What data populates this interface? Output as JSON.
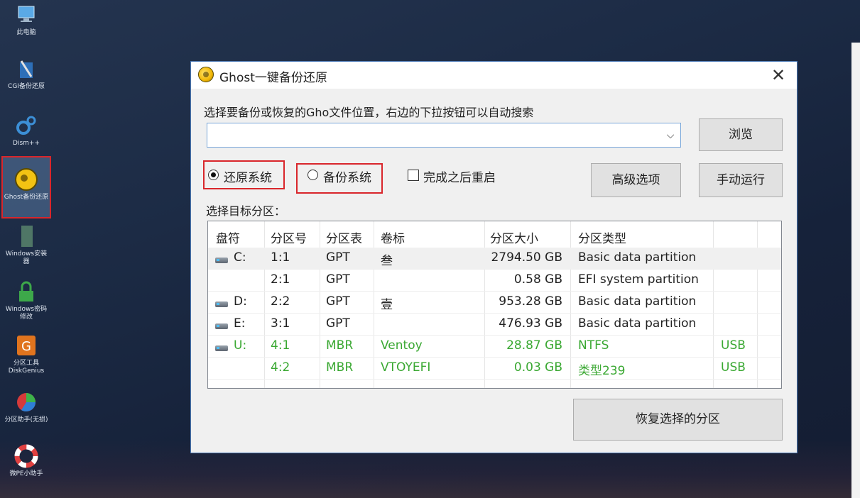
{
  "desktop": {
    "icons": [
      {
        "name": "this-pc",
        "label": "此电脑"
      },
      {
        "name": "cgi-backup",
        "label": "CGI备份还原"
      },
      {
        "name": "dism",
        "label": "Dism++"
      },
      {
        "name": "ghost-backup",
        "label": "Ghost备份还原"
      },
      {
        "name": "windows-installer",
        "label": "Windows安装器"
      },
      {
        "name": "windows-password",
        "label": "Windows密码修改"
      },
      {
        "name": "diskgenius",
        "label": "分区工具DiskGenius"
      },
      {
        "name": "partition-assistant",
        "label": "分区助手(无损)"
      },
      {
        "name": "wepe-helper",
        "label": "微PE小助手"
      }
    ]
  },
  "window": {
    "title": "Ghost一键备份还原",
    "close_glyph": "✕",
    "prompt": "选择要备份或恢复的Gho文件位置，右边的下拉按钮可以自动搜索",
    "path_value": "",
    "combo_arrow": "⌵",
    "browse_label": "浏览",
    "restore_label": "还原系统",
    "backup_label": "备份系统",
    "restart_label": "完成之后重启",
    "restore_checked": true,
    "backup_checked": false,
    "restart_checked": false,
    "advanced_label": "高级选项",
    "manual_label": "手动运行",
    "target_label": "选择目标分区：",
    "restore_partition_label": "恢复选择的分区"
  },
  "table": {
    "headers": [
      "盘符",
      "分区号",
      "分区表",
      "卷标",
      "分区大小",
      "分区类型"
    ],
    "rows": [
      {
        "drive": "C:",
        "num": "1:1",
        "scheme": "GPT",
        "label": "叁",
        "size": "2794.50 GB",
        "type": "Basic data partition",
        "bus": "",
        "usb": false,
        "selected": true
      },
      {
        "drive": "",
        "num": "2:1",
        "scheme": "GPT",
        "label": "",
        "size": "0.58 GB",
        "type": "EFI system partition",
        "bus": "",
        "usb": false,
        "selected": false
      },
      {
        "drive": "D:",
        "num": "2:2",
        "scheme": "GPT",
        "label": "壹",
        "size": "953.28 GB",
        "type": "Basic data partition",
        "bus": "",
        "usb": false,
        "selected": false
      },
      {
        "drive": "E:",
        "num": "3:1",
        "scheme": "GPT",
        "label": "",
        "size": "476.93 GB",
        "type": "Basic data partition",
        "bus": "",
        "usb": false,
        "selected": false
      },
      {
        "drive": "U:",
        "num": "4:1",
        "scheme": "MBR",
        "label": "Ventoy",
        "size": "28.87 GB",
        "type": "NTFS",
        "bus": "USB",
        "usb": true,
        "selected": false
      },
      {
        "drive": "",
        "num": "4:2",
        "scheme": "MBR",
        "label": "VTOYEFI",
        "size": "0.03 GB",
        "type": "类型239",
        "bus": "USB",
        "usb": true,
        "selected": false
      }
    ]
  },
  "colors": {
    "usb_text": "#3aa832",
    "normal_text": "#222222",
    "highlight_box": "#d9262b",
    "window_border": "#4a78b5"
  }
}
